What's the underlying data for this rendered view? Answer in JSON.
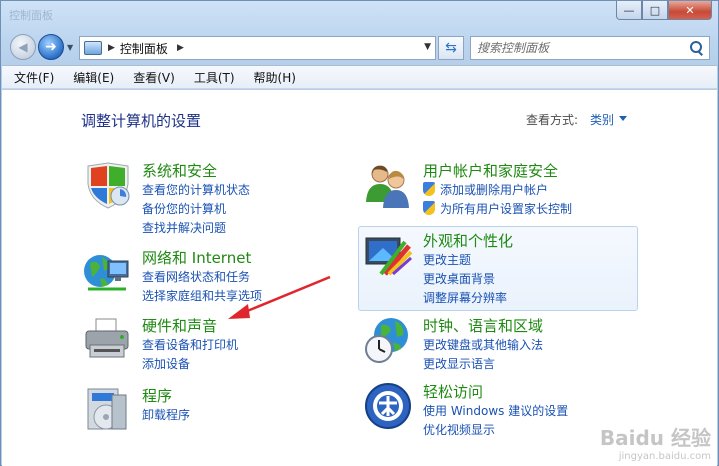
{
  "window": {
    "title": "控制面板",
    "caption": {
      "minimize": "—",
      "maximize": "□",
      "close": "✕"
    }
  },
  "address": {
    "crumb": "控制面板",
    "search_placeholder": "搜索控制面板"
  },
  "menu": [
    "文件(F)",
    "编辑(E)",
    "查看(V)",
    "工具(T)",
    "帮助(H)"
  ],
  "page": {
    "title": "调整计算机的设置",
    "view_by_label": "查看方式:",
    "view_by_value": "类别"
  },
  "categories": [
    {
      "title": "系统和安全",
      "icon": "security-shield-icon",
      "links": [
        "查看您的计算机状态",
        "备份您的计算机",
        "查找并解决问题"
      ]
    },
    {
      "title": "网络和 Internet",
      "icon": "network-globe-icon",
      "links": [
        "查看网络状态和任务",
        "选择家庭组和共享选项"
      ]
    },
    {
      "title": "硬件和声音",
      "icon": "printer-icon",
      "links": [
        "查看设备和打印机",
        "添加设备"
      ]
    },
    {
      "title": "程序",
      "icon": "programs-icon",
      "links": [
        "卸载程序"
      ]
    },
    {
      "title": "用户帐户和家庭安全",
      "icon": "users-icon",
      "links": [
        "添加或删除用户帐户",
        "为所有用户设置家长控制"
      ]
    },
    {
      "title": "外观和个性化",
      "icon": "appearance-icon",
      "links": [
        "更改主题",
        "更改桌面背景",
        "调整屏幕分辨率"
      ]
    },
    {
      "title": "时钟、语言和区域",
      "icon": "clock-globe-icon",
      "links": [
        "更改键盘或其他输入法",
        "更改显示语言"
      ]
    },
    {
      "title": "轻松访问",
      "icon": "ease-of-access-icon",
      "links": [
        "使用 Windows 建议的设置",
        "优化视频显示"
      ]
    }
  ],
  "watermark": {
    "main": "Baidu 经验",
    "sub": "jingyan.baidu.com"
  },
  "colors": {
    "category_title": "#1f8a12",
    "link": "#1a52b3",
    "heading": "#1e3287",
    "arrow": "#e0262c"
  }
}
